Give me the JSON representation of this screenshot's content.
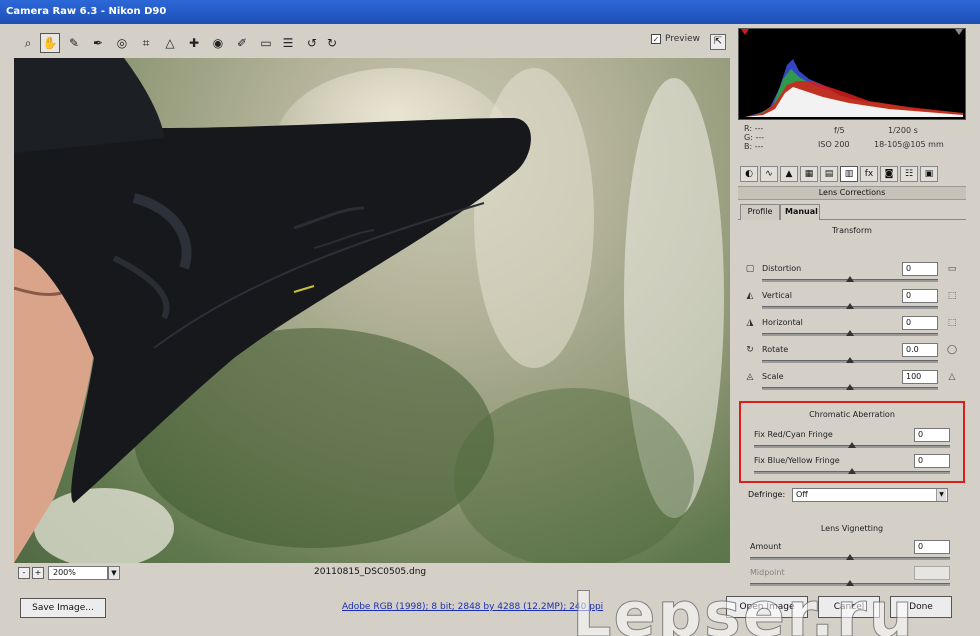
{
  "window": {
    "title": "Camera Raw 6.3 - Nikon D90"
  },
  "toolbar": {
    "tools": [
      "zoom-icon",
      "hand-icon",
      "white-balance-icon",
      "color-sampler-icon",
      "target-adjust-icon",
      "crop-icon",
      "straighten-icon",
      "spot-removal-icon",
      "red-eye-icon",
      "adjustment-brush-icon",
      "graduated-filter-icon",
      "preferences-icon",
      "rotate-left-icon",
      "rotate-right-icon"
    ],
    "tool_glyphs": [
      "⌕",
      "✋",
      "✎",
      "✒",
      "◎",
      "⌗",
      "△",
      "✚",
      "◉",
      "✐",
      "▭",
      "☰",
      "↺",
      "↻"
    ],
    "preview_label": "Preview",
    "preview_checked": "✓",
    "fullscreen_glyph": "⇱"
  },
  "image_status": {
    "zoom_value": "200%",
    "filename": "20110815_DSC0505.dng",
    "minus_glyph": "-",
    "plus_glyph": "+"
  },
  "bottom": {
    "save_label": "Save Image...",
    "workflow_link": "Adobe RGB (1998); 8 bit; 2848 by 4288 (12.2MP); 240 ppi",
    "open_label": "Open Image",
    "cancel_label": "Cancel",
    "done_label": "Done"
  },
  "exif": {
    "r_label": "R:",
    "g_label": "G:",
    "b_label": "B:",
    "r_value": "---",
    "g_value": "---",
    "b_value": "---",
    "aperture": "f/5",
    "shutter": "1/200 s",
    "iso": "ISO 200",
    "lens": "18-105@105 mm"
  },
  "panel_tabs": [
    "basic-icon",
    "tone-curve-icon",
    "detail-icon",
    "hsl-icon",
    "split-toning-icon",
    "lens-corrections-icon",
    "effects-icon",
    "camera-calibration-icon",
    "presets-icon",
    "snapshots-icon"
  ],
  "panel_tab_glyphs": [
    "◐",
    "∿",
    "▲",
    "▦",
    "▤",
    "▥",
    "fx",
    "◙",
    "☷",
    "▣"
  ],
  "lens": {
    "panel_title": "Lens Corrections",
    "tab_profile": "Profile",
    "tab_manual": "Manual",
    "transform_title": "Transform",
    "transform": [
      {
        "label": "Distortion",
        "value": "0",
        "thumb": 0.5
      },
      {
        "label": "Vertical",
        "value": "0",
        "thumb": 0.5
      },
      {
        "label": "Horizontal",
        "value": "0",
        "thumb": 0.5
      },
      {
        "label": "Rotate",
        "value": "0.0",
        "thumb": 0.5
      },
      {
        "label": "Scale",
        "value": "100",
        "thumb": 0.5
      }
    ],
    "ca_title": "Chromatic Aberration",
    "ca": [
      {
        "label": "Fix Red/Cyan Fringe",
        "value": "0",
        "thumb": 0.5
      },
      {
        "label": "Fix Blue/Yellow Fringe",
        "value": "0",
        "thumb": 0.5
      }
    ],
    "defringe_label": "Defringe:",
    "defringe_value": "Off",
    "vignetting_title": "Lens Vignetting",
    "vignetting": [
      {
        "label": "Amount",
        "value": "0",
        "thumb": 0.5
      },
      {
        "label": "Midpoint",
        "value": "",
        "thumb": 0.5
      }
    ]
  },
  "watermark": "Lepser.ru"
}
